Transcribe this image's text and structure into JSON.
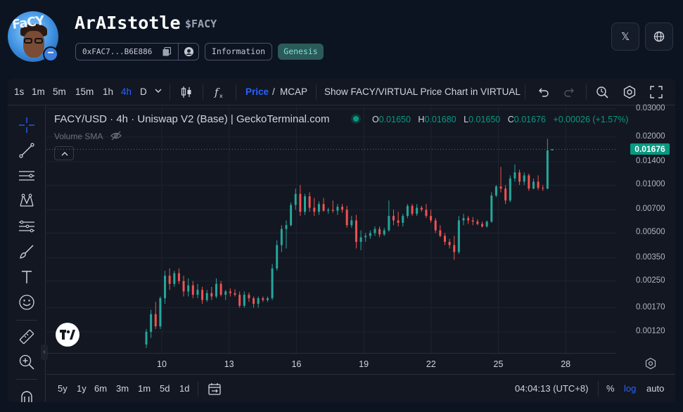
{
  "token": {
    "name": "ArAIstotle",
    "symbol": "$FACY",
    "avatar_text": "FaCY",
    "address_short": "0xFAC7...B6E886",
    "info_label": "Information",
    "genesis_label": "Genesis"
  },
  "header_buttons": [
    {
      "name": "x-icon",
      "glyph": "𝕏"
    },
    {
      "name": "globe-icon",
      "glyph": "globe"
    }
  ],
  "toolbar": {
    "intervals": [
      "1s",
      "1m",
      "5m",
      "15m",
      "1h",
      "4h",
      "D"
    ],
    "active_interval": "4h",
    "price_label": "Price",
    "divider": "/",
    "mcap_label": "MCAP",
    "show_pair_label": "Show FACY/VIRTUAL Price Chart in VIRTUAL"
  },
  "legend": {
    "title": "FACY/USD · 4h · Uniswap V2 (Base) | GeckoTerminal.com",
    "o_label": "O",
    "o_value": "0.01650",
    "h_label": "H",
    "h_value": "0.01680",
    "l_label": "L",
    "l_value": "0.01650",
    "c_label": "C",
    "c_value": "0.01676",
    "change": "+0.00026 (+1.57%)",
    "volume_label": "Volume SMA"
  },
  "price_axis": {
    "labels": [
      "0.03000",
      "0.02000",
      "0.01400",
      "0.01000",
      "0.00700",
      "0.00500",
      "0.00350",
      "0.00250",
      "0.00170",
      "0.00120"
    ],
    "current_price": "0.01676"
  },
  "time_axis": {
    "labels": [
      "10",
      "13",
      "16",
      "19",
      "22",
      "25",
      "28"
    ]
  },
  "bottom_bar": {
    "ranges": [
      "5y",
      "1y",
      "6m",
      "3m",
      "1m",
      "5d",
      "1d"
    ],
    "clock": "04:04:13 (UTC+8)",
    "percent_label": "%",
    "log_label": "log",
    "auto_label": "auto"
  },
  "colors": {
    "up": "#26a69a",
    "down": "#ef5350",
    "accent": "#2962ff",
    "badge": "#089981"
  },
  "chart_data": {
    "type": "candlestick",
    "scale": "log",
    "series_name": "FACY/USD",
    "x_label": "",
    "y_label": "",
    "y_range": [
      0.001,
      0.03
    ],
    "x_range_days": [
      "9",
      "28"
    ],
    "candles": [
      [
        0.001,
        0.00125,
        0.00095,
        0.0012
      ],
      [
        0.0012,
        0.00165,
        0.0011,
        0.00155
      ],
      [
        0.00155,
        0.00185,
        0.00125,
        0.0013
      ],
      [
        0.0013,
        0.002,
        0.00125,
        0.00195
      ],
      [
        0.00195,
        0.0029,
        0.0018,
        0.0027
      ],
      [
        0.0027,
        0.003,
        0.0022,
        0.0024
      ],
      [
        0.0024,
        0.0029,
        0.0023,
        0.0028
      ],
      [
        0.0028,
        0.003,
        0.0024,
        0.0025
      ],
      [
        0.0025,
        0.0027,
        0.002,
        0.00215
      ],
      [
        0.00215,
        0.0026,
        0.002,
        0.00235
      ],
      [
        0.00235,
        0.0025,
        0.00195,
        0.00205
      ],
      [
        0.00205,
        0.0024,
        0.00195,
        0.0022
      ],
      [
        0.0022,
        0.0023,
        0.0018,
        0.0019
      ],
      [
        0.0019,
        0.0022,
        0.00185,
        0.0021
      ],
      [
        0.0021,
        0.0023,
        0.0019,
        0.002
      ],
      [
        0.002,
        0.0026,
        0.00195,
        0.0024
      ],
      [
        0.0024,
        0.0025,
        0.002,
        0.00205
      ],
      [
        0.00205,
        0.0022,
        0.0019,
        0.00215
      ],
      [
        0.00215,
        0.00225,
        0.002,
        0.0021
      ],
      [
        0.0021,
        0.00222,
        0.002,
        0.00205
      ],
      [
        0.00205,
        0.00215,
        0.0017,
        0.00175
      ],
      [
        0.00175,
        0.00215,
        0.0017,
        0.00205
      ],
      [
        0.00205,
        0.00212,
        0.00185,
        0.00195
      ],
      [
        0.00195,
        0.002,
        0.0017,
        0.0018
      ],
      [
        0.0018,
        0.002,
        0.0017,
        0.00195
      ],
      [
        0.00195,
        0.002,
        0.00185,
        0.0019
      ],
      [
        0.0019,
        0.002,
        0.00185,
        0.00195
      ],
      [
        0.00195,
        0.0032,
        0.0019,
        0.003
      ],
      [
        0.003,
        0.0045,
        0.0029,
        0.0042
      ],
      [
        0.0042,
        0.0056,
        0.0038,
        0.0053
      ],
      [
        0.0053,
        0.006,
        0.004,
        0.0056
      ],
      [
        0.0056,
        0.0078,
        0.0055,
        0.0075
      ],
      [
        0.0075,
        0.0095,
        0.007,
        0.0088
      ],
      [
        0.0088,
        0.01,
        0.0064,
        0.0068
      ],
      [
        0.0068,
        0.0088,
        0.0065,
        0.0085
      ],
      [
        0.0085,
        0.009,
        0.0068,
        0.0072
      ],
      [
        0.0072,
        0.0083,
        0.0064,
        0.0068
      ],
      [
        0.0068,
        0.0079,
        0.0065,
        0.0076
      ],
      [
        0.0076,
        0.0083,
        0.0068,
        0.0069
      ],
      [
        0.0069,
        0.0072,
        0.0066,
        0.007
      ],
      [
        0.007,
        0.008,
        0.0067,
        0.0069
      ],
      [
        0.0069,
        0.0076,
        0.0065,
        0.0073
      ],
      [
        0.0073,
        0.0076,
        0.0067,
        0.007
      ],
      [
        0.007,
        0.0074,
        0.0054,
        0.0056
      ],
      [
        0.0056,
        0.0064,
        0.0054,
        0.006
      ],
      [
        0.006,
        0.0065,
        0.004,
        0.0044
      ],
      [
        0.0044,
        0.0052,
        0.0039,
        0.0047
      ],
      [
        0.0047,
        0.005,
        0.0044,
        0.0048
      ],
      [
        0.0048,
        0.0052,
        0.0046,
        0.005
      ],
      [
        0.005,
        0.0055,
        0.0048,
        0.0053
      ],
      [
        0.0053,
        0.0055,
        0.0047,
        0.0049
      ],
      [
        0.0049,
        0.0054,
        0.0048,
        0.0052
      ],
      [
        0.0052,
        0.008,
        0.0051,
        0.0064
      ],
      [
        0.0064,
        0.007,
        0.0056,
        0.006
      ],
      [
        0.006,
        0.0068,
        0.0055,
        0.0058
      ],
      [
        0.0058,
        0.0066,
        0.0055,
        0.0064
      ],
      [
        0.0064,
        0.0076,
        0.0062,
        0.0074
      ],
      [
        0.0074,
        0.0076,
        0.0064,
        0.0066
      ],
      [
        0.0066,
        0.0076,
        0.0064,
        0.0072
      ],
      [
        0.0072,
        0.0074,
        0.0068,
        0.007
      ],
      [
        0.007,
        0.0076,
        0.0062,
        0.0064
      ],
      [
        0.0064,
        0.007,
        0.0058,
        0.006
      ],
      [
        0.006,
        0.0062,
        0.005,
        0.0052
      ],
      [
        0.0052,
        0.0056,
        0.0047,
        0.0048
      ],
      [
        0.0048,
        0.005,
        0.0042,
        0.0044
      ],
      [
        0.0044,
        0.0046,
        0.004,
        0.0042
      ],
      [
        0.0042,
        0.0048,
        0.0034,
        0.0038
      ],
      [
        0.0038,
        0.0064,
        0.0037,
        0.006
      ],
      [
        0.006,
        0.0066,
        0.0056,
        0.0062
      ],
      [
        0.0062,
        0.0064,
        0.0057,
        0.006
      ],
      [
        0.006,
        0.0063,
        0.0056,
        0.0059
      ],
      [
        0.0059,
        0.0061,
        0.0056,
        0.0057
      ],
      [
        0.0057,
        0.0059,
        0.0054,
        0.0055
      ],
      [
        0.0055,
        0.006,
        0.0054,
        0.0059
      ],
      [
        0.0059,
        0.009,
        0.0058,
        0.0086
      ],
      [
        0.0086,
        0.01,
        0.0084,
        0.0098
      ],
      [
        0.0098,
        0.013,
        0.009,
        0.0095
      ],
      [
        0.0095,
        0.01,
        0.0076,
        0.008
      ],
      [
        0.008,
        0.0115,
        0.0078,
        0.011
      ],
      [
        0.011,
        0.0135,
        0.0105,
        0.012
      ],
      [
        0.012,
        0.0125,
        0.01,
        0.0105
      ],
      [
        0.0105,
        0.012,
        0.01,
        0.0115
      ],
      [
        0.0115,
        0.0118,
        0.0092,
        0.0095
      ],
      [
        0.0095,
        0.011,
        0.0094,
        0.0105
      ],
      [
        0.0105,
        0.0115,
        0.0093,
        0.0096
      ],
      [
        0.0096,
        0.01,
        0.0092,
        0.0095
      ],
      [
        0.0095,
        0.0195,
        0.0094,
        0.0165
      ],
      [
        0.0165,
        0.0168,
        0.0165,
        0.01676
      ]
    ]
  }
}
